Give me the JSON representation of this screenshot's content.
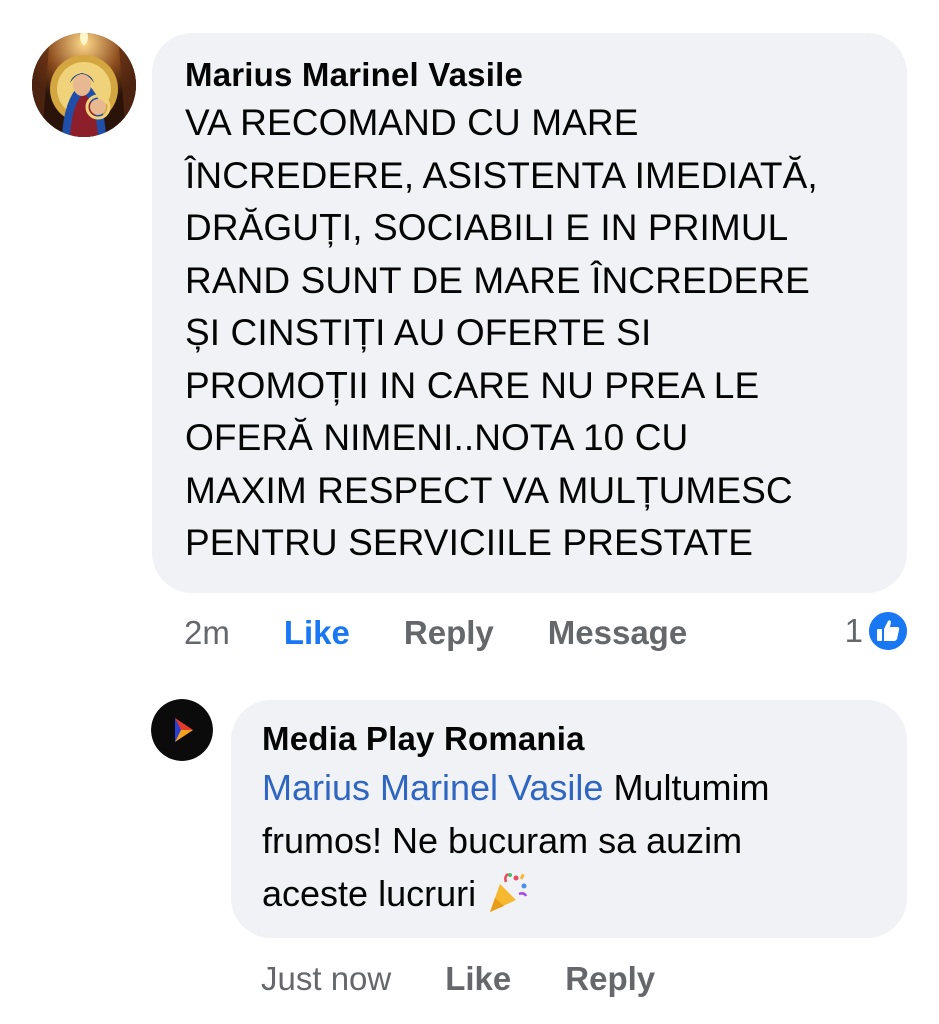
{
  "comment": {
    "author": "Marius Marinel Vasile",
    "text": "VA RECOMAND CU MARE\nÎNCREDERE, ASISTENTA IMEDIATĂ,\nDRĂGUȚI, SOCIABILI E IN PRIMUL\nRAND SUNT DE MARE ÎNCREDERE\nȘI CINSTIȚI AU OFERTE SI\nPROMOȚII IN CARE NU PREA LE\nOFERĂ NIMENI..NOTA 10 CU\nMAXIM RESPECT VA MULȚUMESC\nPENTRU SERVICIILE PRESTATE",
    "time": "2m",
    "like_label": "Like",
    "reply_label": "Reply",
    "message_label": "Message",
    "reaction_count": "1",
    "reaction_icon": "like-thumb-icon",
    "like_color": "#1877f2"
  },
  "reply": {
    "author": "Media Play Romania",
    "mention": "Marius Marinel Vasile",
    "text_line1": " Multumim",
    "text_line2": "frumos! Ne bucuram sa auzim",
    "text_line3": "aceste lucruri ",
    "emoji": "party-popper-icon",
    "time": "Just now",
    "like_label": "Like",
    "reply_label": "Reply",
    "mention_color": "#2f66c2"
  }
}
